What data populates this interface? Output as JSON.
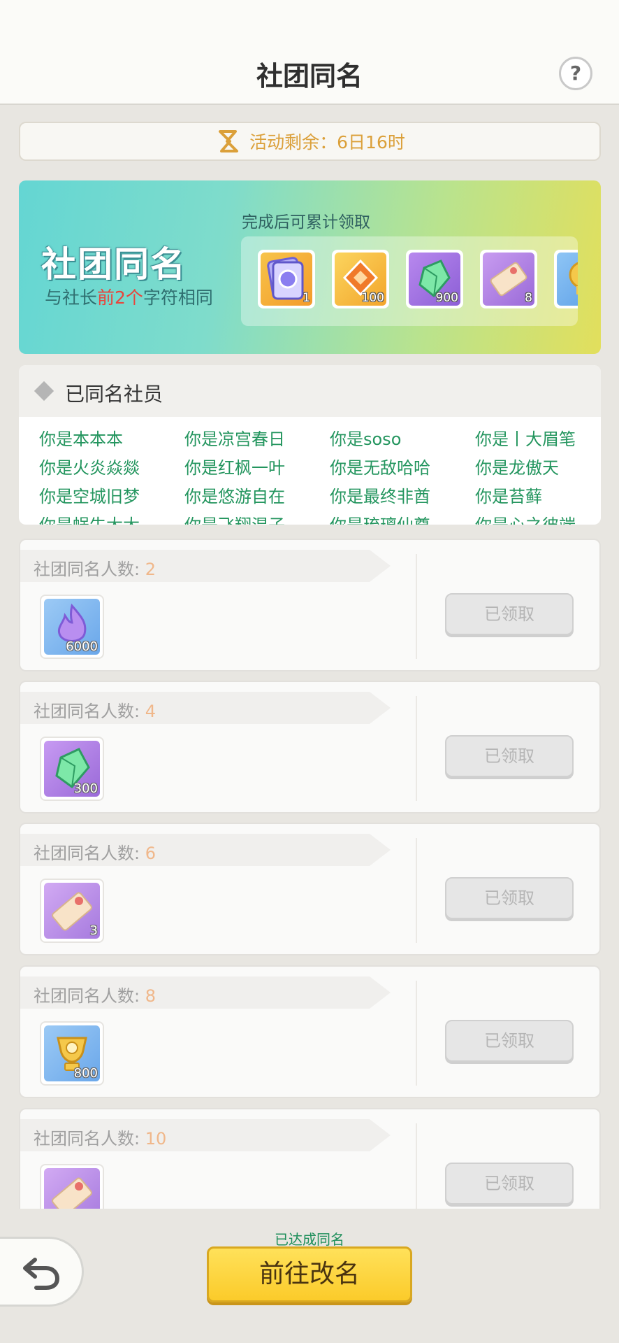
{
  "header": {
    "title": "社团同名",
    "help_icon": "?"
  },
  "timer": {
    "text": "活动剩余：6日16时"
  },
  "banner": {
    "title": "社团同名",
    "subtitle_prefix": "与社长",
    "subtitle_highlight": "前2个",
    "subtitle_suffix": "字符相同",
    "reward_label": "完成后可累计领取",
    "rewards": [
      {
        "icon": "card-pack-icon",
        "qty": "1"
      },
      {
        "icon": "orange-ticket-icon",
        "qty": "100"
      },
      {
        "icon": "green-crystal-icon",
        "qty": "900"
      },
      {
        "icon": "scroll-ticket-icon",
        "qty": "8"
      },
      {
        "icon": "trophy-icon",
        "qty": ""
      }
    ]
  },
  "members": {
    "title": "已同名社员",
    "names": [
      "你是本本本",
      "你是凉宫春日",
      "你是soso",
      "你是丨大眉笔",
      "你是火炎焱燚",
      "你是红枫一叶",
      "你是无敌哈哈",
      "你是龙傲天",
      "你是空城旧梦",
      "你是悠游自在",
      "你是最终非酋",
      "你是苔藓",
      "你是蜗牛大大",
      "你是飞翔混子",
      "你是琉璃仙尊",
      "你是心之彼端"
    ]
  },
  "rows": [
    {
      "label": "社团同名人数: ",
      "count": "2",
      "item_icon": "purple-flame-icon",
      "qty": "6000",
      "button": "已领取"
    },
    {
      "label": "社团同名人数: ",
      "count": "4",
      "item_icon": "green-crystal-icon",
      "qty": "300",
      "button": "已领取"
    },
    {
      "label": "社团同名人数: ",
      "count": "6",
      "item_icon": "scroll-ticket-icon",
      "qty": "3",
      "button": "已领取"
    },
    {
      "label": "社团同名人数: ",
      "count": "8",
      "item_icon": "trophy-icon",
      "qty": "800",
      "button": "已领取"
    },
    {
      "label": "社团同名人数: ",
      "count": "10",
      "item_icon": "scroll-ticket-icon",
      "qty": "",
      "button": "已领取"
    }
  ],
  "bottom": {
    "status": "已达成同名",
    "rename_button": "前往改名",
    "back_icon": "back-arrow-icon"
  }
}
